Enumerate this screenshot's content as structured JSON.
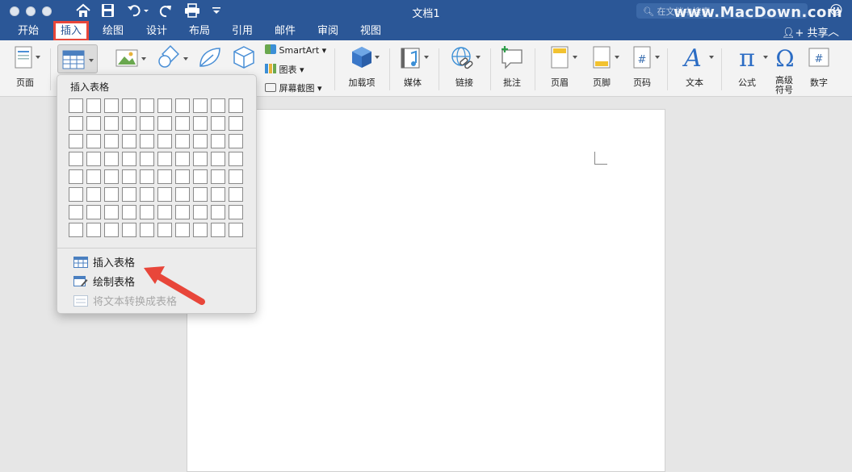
{
  "window": {
    "title": "文档1",
    "search_placeholder": "在文档中搜索",
    "watermark": "www.MacDown.com"
  },
  "tabs": [
    {
      "label": "开始"
    },
    {
      "label": "插入",
      "active": true
    },
    {
      "label": "绘图"
    },
    {
      "label": "设计"
    },
    {
      "label": "布局"
    },
    {
      "label": "引用"
    },
    {
      "label": "邮件"
    },
    {
      "label": "审阅"
    },
    {
      "label": "视图"
    }
  ],
  "share_label": "共享",
  "ribbon": {
    "page": "页面",
    "smartart": "SmartArt",
    "chart": "图表",
    "screenshot": "屏幕截图",
    "addins": "加载项",
    "media": "媒体",
    "link": "链接",
    "comment": "批注",
    "header": "页眉",
    "footer": "页脚",
    "page_number": "页码",
    "text": "文本",
    "equation": "公式",
    "advanced_symbol_1": "高级",
    "advanced_symbol_2": "符号",
    "number": "数字"
  },
  "dropdown": {
    "header": "插入表格",
    "items": [
      {
        "label": "插入表格",
        "enabled": true
      },
      {
        "label": "绘制表格",
        "enabled": true
      },
      {
        "label": "将文本转换成表格",
        "enabled": false
      }
    ]
  },
  "colors": {
    "titlebar": "#2b5797",
    "highlight": "#e8463a",
    "accent_blue": "#2b6cc4"
  }
}
